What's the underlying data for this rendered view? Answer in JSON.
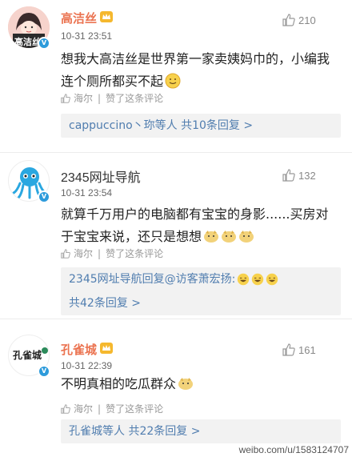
{
  "comments": [
    {
      "avatar_label": "高洁丝",
      "username": "高洁丝",
      "time": "10-31 23:51",
      "likes": "210",
      "text": "想我大高洁丝是世界第一家卖姨妈巾的，小编我连个厕所都买不起",
      "liked_by": "海尔",
      "liked_action": "赞了这条评论",
      "reply_summary": "cappuccino丶珎等人",
      "reply_count": "共10条回复 >"
    },
    {
      "username": "2345网址导航",
      "time": "10-31 23:54",
      "likes": "132",
      "text": "就算千万用户的电脑都有宝宝的身影......买房对于宝宝来说，还只是想想",
      "liked_by": "海尔",
      "liked_action": "赞了这条评论",
      "reply_preview_author": "2345网址导航回复",
      "reply_preview_target": "@访客萧宏扬:",
      "reply_count": "共42条回复 >"
    },
    {
      "avatar_label": "孔雀城",
      "username": "孔雀城",
      "time": "10-31 22:39",
      "likes": "161",
      "text": "不明真相的吃瓜群众",
      "liked_by": "海尔",
      "liked_action": "赞了这条评论",
      "reply_summary": "孔雀城等人",
      "reply_count": "共22条回复 >"
    }
  ],
  "watermark": "weibo.com/u/1583124707"
}
